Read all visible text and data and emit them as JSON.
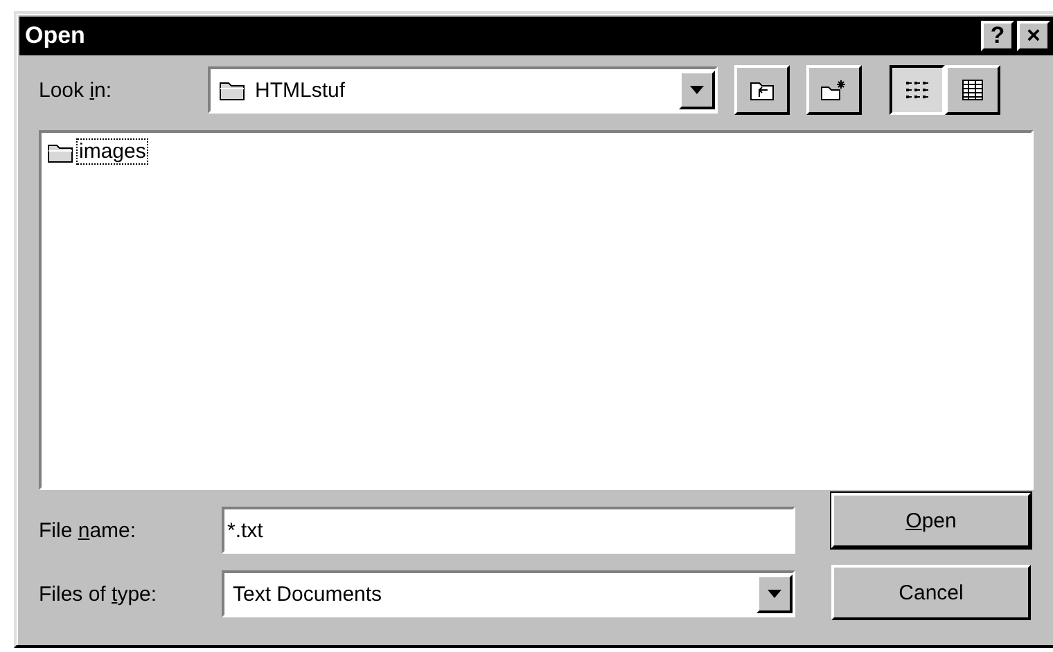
{
  "window": {
    "title": "Open",
    "controls": [
      "?",
      "×"
    ]
  },
  "look_in": {
    "label": {
      "before": "Look ",
      "key": "i",
      "after": "n:"
    },
    "value": "HTMLstuf"
  },
  "toolbar": [
    {
      "kind": "up",
      "selected": false
    },
    {
      "kind": "new",
      "selected": false
    },
    {
      "kind": "list",
      "selected": true
    },
    {
      "kind": "details",
      "selected": false
    }
  ],
  "files": [
    {
      "name": "images",
      "selected": true
    }
  ],
  "file_name": {
    "label": {
      "before": "File ",
      "key": "n",
      "after": "ame:"
    },
    "value": "*.txt"
  },
  "file_type": {
    "label": {
      "before": "Files of ",
      "key": "t",
      "after": "ype:"
    },
    "value": "Text Documents"
  },
  "buttons": [
    {
      "label": {
        "key": "O",
        "after": "pen"
      },
      "default": true
    },
    {
      "label": {
        "before": "Cancel"
      },
      "default": false
    }
  ]
}
